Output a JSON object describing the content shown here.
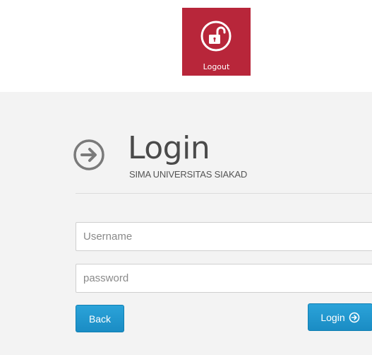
{
  "logout_tile": {
    "label": "Logout",
    "icon": "unlock-icon",
    "color": "#b8263a"
  },
  "login": {
    "title": "Login",
    "subtitle": "SIMA UNIVERSITAS SIAKAD",
    "header_icon": "arrow-right-circle-icon",
    "username": {
      "placeholder": "Username",
      "value": ""
    },
    "password": {
      "placeholder": "password",
      "value": ""
    },
    "back_label": "Back",
    "login_label": "Login",
    "login_icon": "arrow-right-circle-icon",
    "accent_color": "#1a8cc4"
  }
}
